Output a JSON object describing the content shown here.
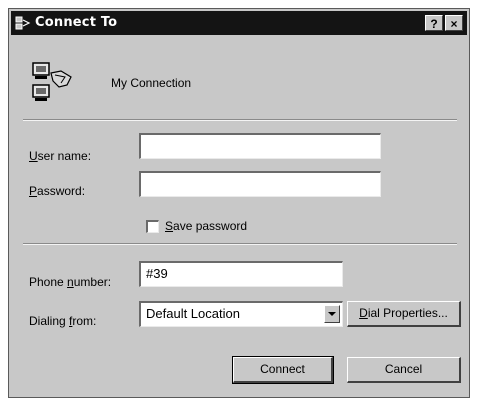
{
  "window": {
    "title": "Connect To",
    "help_label": "?",
    "close_label": "×"
  },
  "connection": {
    "name": "My Connection",
    "icon": "network-computers-icon"
  },
  "fields": {
    "username_label_key": "U",
    "username_label_rest": "ser name:",
    "username_value": "",
    "password_label_key": "P",
    "password_label_rest": "assword:",
    "password_value": "",
    "save_password_key": "S",
    "save_password_rest": "ave password",
    "save_password_checked": false,
    "phone_label_pre": "Phone ",
    "phone_label_key": "n",
    "phone_label_rest": "umber:",
    "phone_value": "#39",
    "dialing_label_pre": "Dialing ",
    "dialing_label_key": "f",
    "dialing_label_rest": "rom:",
    "dialing_value": "Default Location"
  },
  "buttons": {
    "dial_properties_key": "D",
    "dial_properties_rest": "ial Properties...",
    "connect": "Connect",
    "cancel": "Cancel"
  }
}
